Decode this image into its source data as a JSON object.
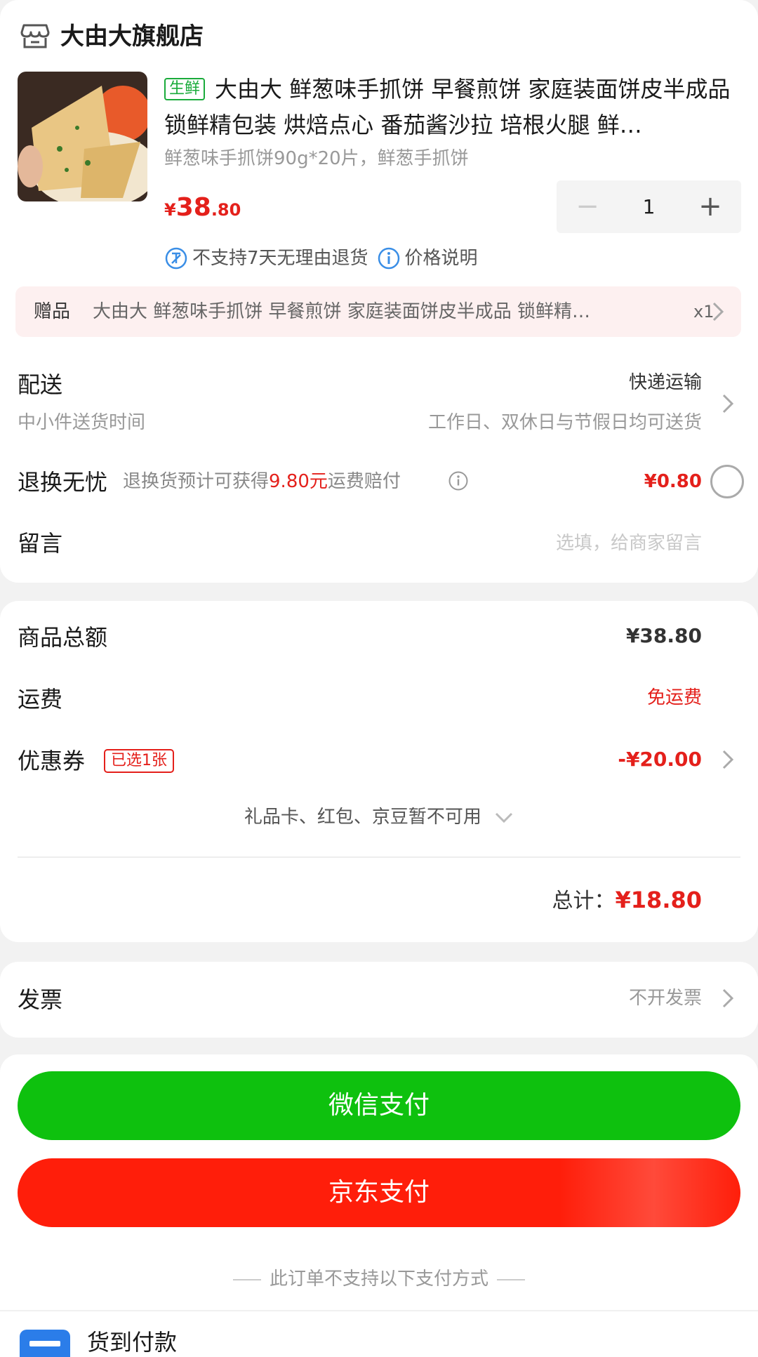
{
  "shop": {
    "name": "大由大旗舰店"
  },
  "product": {
    "tag": "生鲜",
    "title": "大由大 鲜葱味手抓饼 早餐煎饼 家庭装面饼皮半成品 锁鲜精包装 烘焙点心 番茄酱沙拉 培根火腿 鲜…",
    "spec": "鲜葱味手抓饼90g*20片，鲜葱手抓饼",
    "price_currency": "¥",
    "price_int": "38",
    "price_dec": ".80",
    "quantity": "1",
    "notices": [
      "不支持7天无理由退货",
      "价格说明"
    ]
  },
  "gift": {
    "label": "赠品",
    "text": "大由大 鲜葱味手抓饼 早餐煎饼 家庭装面饼皮半成品 锁鲜精…",
    "count": "x1"
  },
  "delivery": {
    "label": "配送",
    "method": "快递运输",
    "sub_label": "中小件送货时间",
    "sub_value": "工作日、双休日与节假日均可送货"
  },
  "return_insurance": {
    "label": "退换无忧",
    "desc_prefix": "退换货预计可获得",
    "desc_amount": "9.80元",
    "desc_suffix": "运费赔付",
    "price": "¥0.80"
  },
  "message": {
    "label": "留言",
    "placeholder": "选填，给商家留言"
  },
  "summary": {
    "goods_label": "商品总额",
    "goods_value": "¥38.80",
    "shipping_label": "运费",
    "shipping_value": "免运费",
    "coupon_label": "优惠券",
    "coupon_badge": "已选1张",
    "coupon_value": "-¥20.00",
    "unavailable": "礼品卡、红包、京豆暂不可用",
    "total_label": "总计：",
    "total_value": "¥18.80"
  },
  "invoice": {
    "label": "发票",
    "value": "不开发票"
  },
  "payment": {
    "wechat": "微信支付",
    "jd": "京东支付",
    "unsupported_note": "此订单不支持以下支付方式",
    "cod": "货到付款"
  },
  "colors": {
    "red": "#e4201b",
    "green": "#1aab3b",
    "wechat": "#0ec10e",
    "jd": "#ff1e0a"
  }
}
